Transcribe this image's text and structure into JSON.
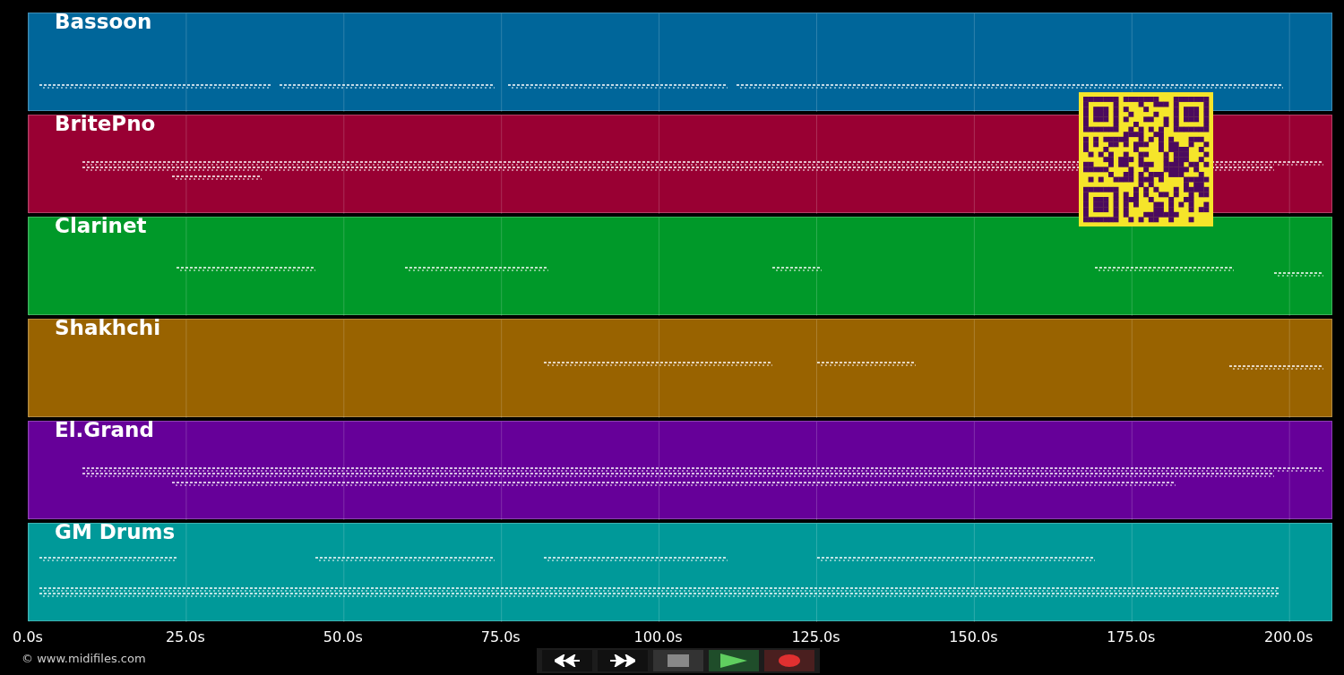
{
  "tracks": [
    {
      "name": "Bassoon",
      "color": "#00669a"
    },
    {
      "name": "BritePno",
      "color": "#990033"
    },
    {
      "name": "Clarinet",
      "color": "#009929"
    },
    {
      "name": "Shakhchi",
      "color": "#996300"
    },
    {
      "name": "El.Grand",
      "color": "#660099"
    },
    {
      "name": "GM Drums",
      "color": "#009999"
    }
  ],
  "axis": {
    "ticks": [
      "0.0s",
      "25.0s",
      "50.0s",
      "75.0s",
      "100.0s",
      "125.0s",
      "150.0s",
      "175.0s",
      "200.0s"
    ]
  },
  "credit": "© www.midifiles.com",
  "controls": [
    {
      "kind": "rewind"
    },
    {
      "kind": "forward"
    },
    {
      "kind": "stop"
    },
    {
      "kind": "play"
    },
    {
      "kind": "record"
    }
  ]
}
